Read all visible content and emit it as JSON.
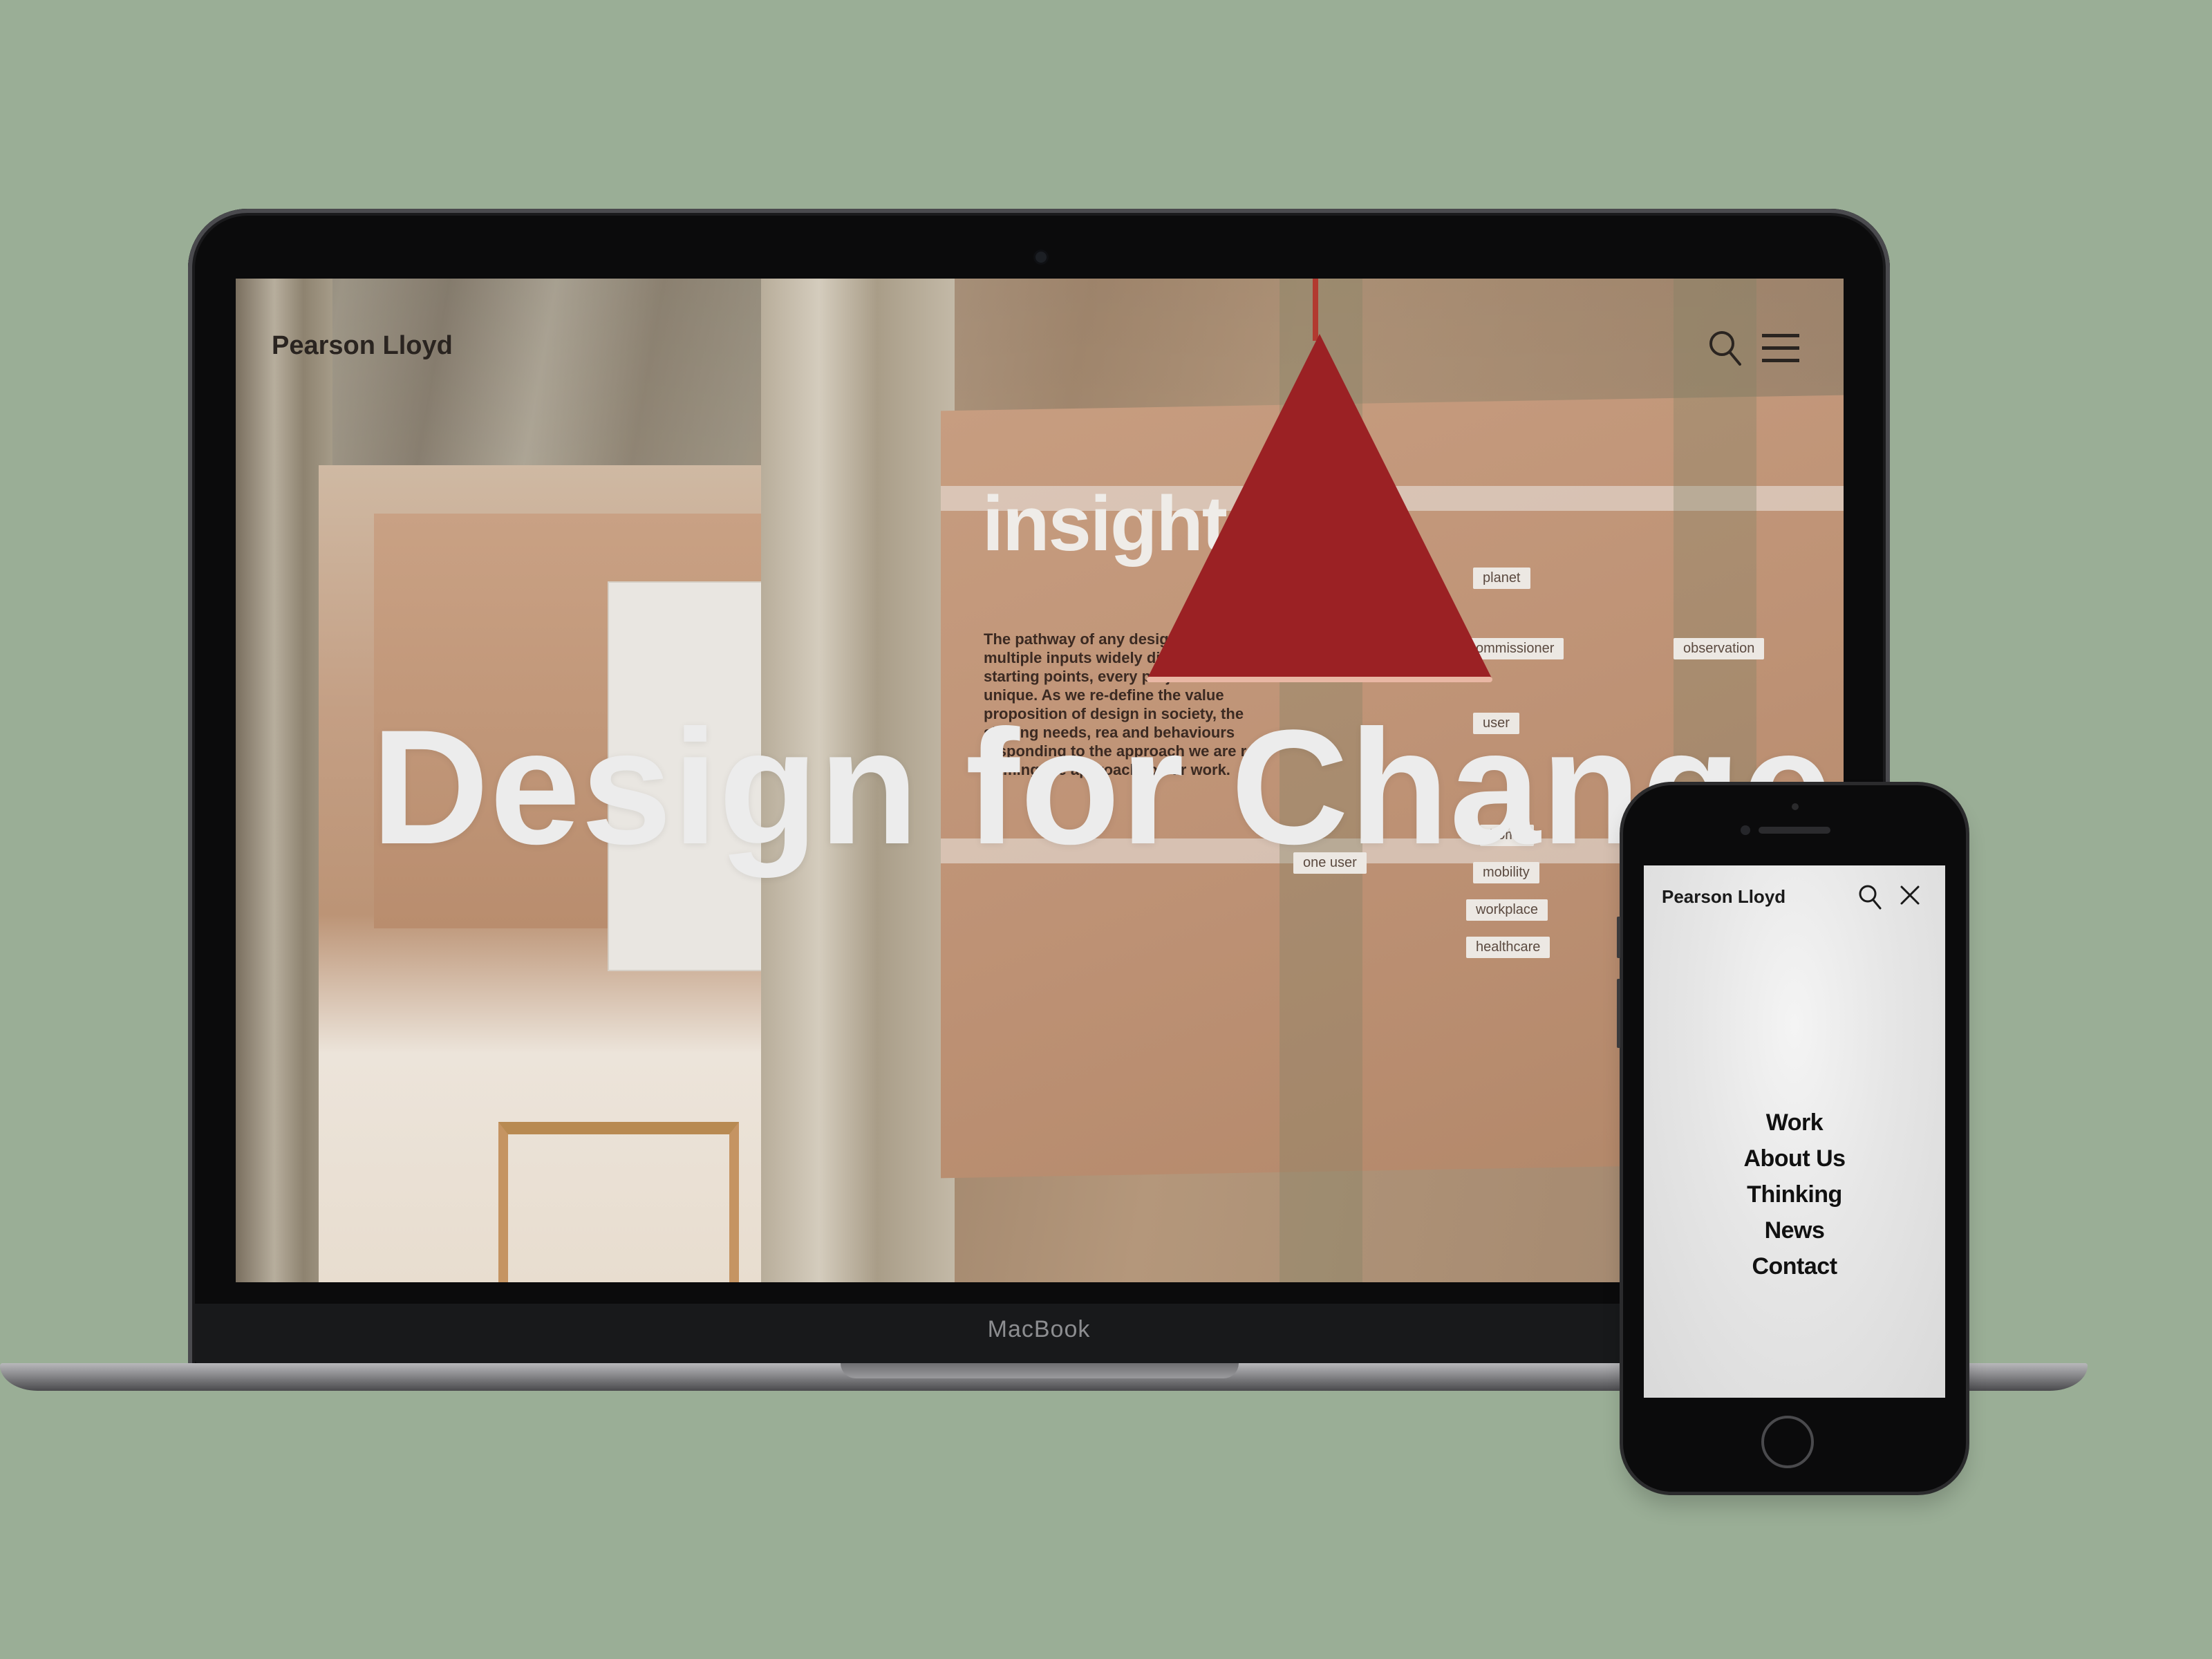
{
  "laptop": {
    "brand_label": "MacBook",
    "website": {
      "logo": "Pearson Lloyd",
      "hero_title": "Design for Change",
      "icons": {
        "search": "search-icon",
        "menu": "hamburger-menu-icon"
      },
      "scene": {
        "board_heading": "insight",
        "board_paragraph": "The pathway of any design framed by multiple inputs widely different starting points, every project is unique. As we re-define the value proposition of design in society, the shifting needs, rea and behaviours responding to the approach we are re-framing the approach to our work.",
        "flow_nodes": [
          "planet",
          "commissioner",
          "observation",
          "user",
          "one user",
          "home",
          "mobility",
          "workplace",
          "healthcare"
        ]
      }
    }
  },
  "phone": {
    "website": {
      "logo": "Pearson Lloyd",
      "icons": {
        "search": "search-icon",
        "close": "close-icon"
      },
      "nav": [
        {
          "label": "Work"
        },
        {
          "label": "About Us"
        },
        {
          "label": "Thinking"
        },
        {
          "label": "News"
        },
        {
          "label": "Contact"
        }
      ]
    }
  },
  "colors": {
    "background": "#9aae96",
    "device_body": "#0b0b0c",
    "lamp": "#9b2124",
    "hero_text": "#ececec"
  }
}
